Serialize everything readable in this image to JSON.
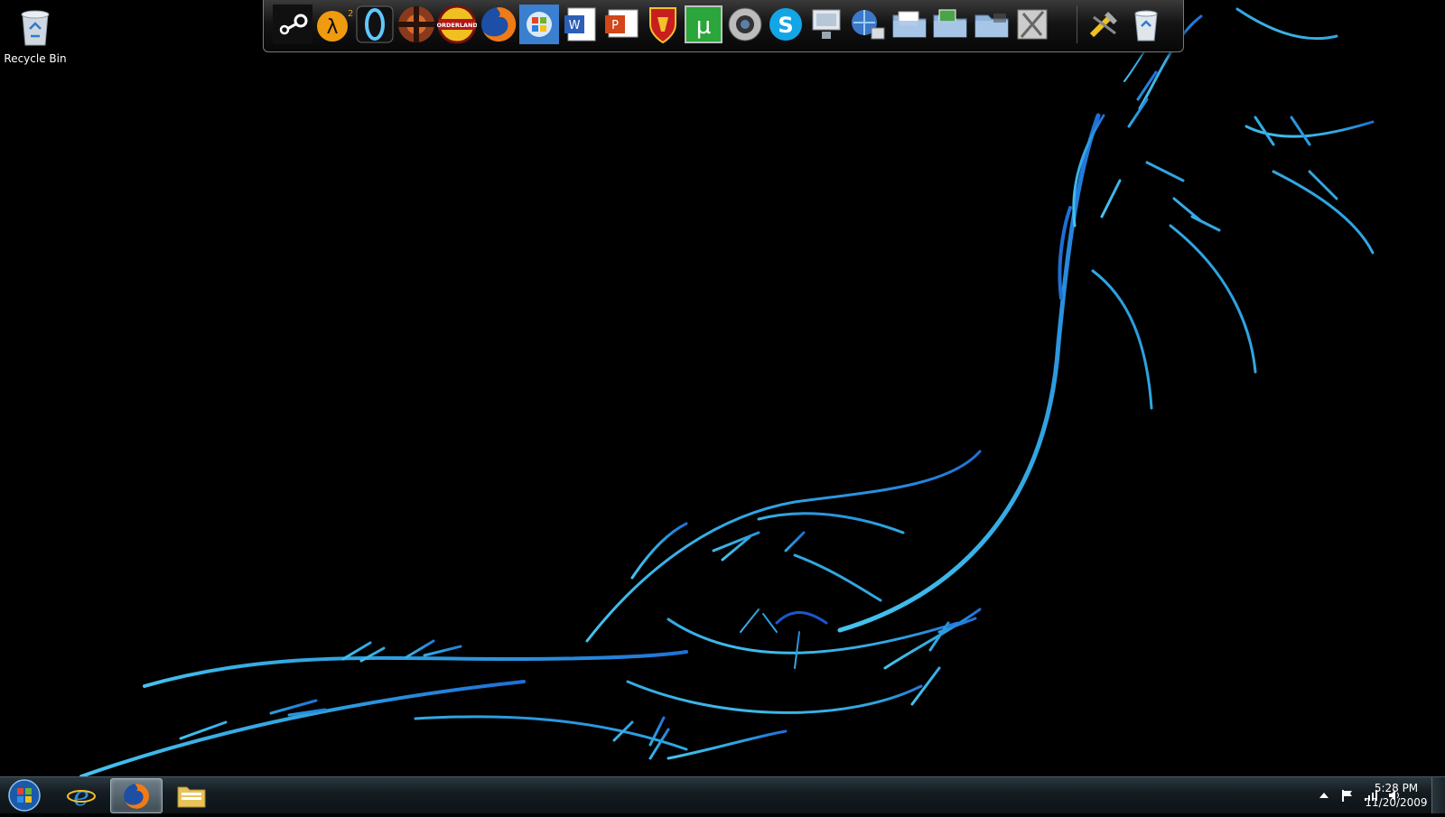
{
  "desktop": {
    "icons": [
      {
        "label": "Recycle Bin",
        "icon": "recycle-bin-icon"
      }
    ]
  },
  "dock": {
    "items": [
      {
        "app": "Steam",
        "icon": "steam-icon"
      },
      {
        "app": "Half-Life 2",
        "icon": "half-life-2-icon"
      },
      {
        "app": "Portal",
        "icon": "portal-icon"
      },
      {
        "app": "Team Fortress 2",
        "icon": "team-fortress-2-icon"
      },
      {
        "app": "Borderlands",
        "icon": "borderlands-icon",
        "text": "BORDERLANDS"
      },
      {
        "app": "Firefox",
        "icon": "firefox-icon"
      },
      {
        "app": "Windows",
        "icon": "windows-icon"
      },
      {
        "app": "Word",
        "icon": "word-icon"
      },
      {
        "app": "PowerPoint",
        "icon": "powerpoint-icon"
      },
      {
        "app": "Game Shield",
        "icon": "shield-game-icon"
      },
      {
        "app": "uTorrent",
        "icon": "utorrent-icon"
      },
      {
        "app": "Webcam",
        "icon": "webcam-icon"
      },
      {
        "app": "Skype",
        "icon": "skype-icon"
      },
      {
        "app": "Computer",
        "icon": "computer-icon"
      },
      {
        "app": "Network",
        "icon": "network-icon"
      },
      {
        "app": "Documents",
        "icon": "documents-folder-icon"
      },
      {
        "app": "Pictures",
        "icon": "pictures-folder-icon"
      },
      {
        "app": "Downloads",
        "icon": "downloads-folder-icon"
      },
      {
        "app": "Control Panel",
        "icon": "control-panel-icon"
      },
      {
        "app": "Tools",
        "icon": "tools-icon"
      },
      {
        "app": "Recycle Bin",
        "icon": "dock-recycle-bin-icon"
      }
    ]
  },
  "taskbar": {
    "pinned": [
      {
        "app": "Internet Explorer",
        "icon": "internet-explorer-icon",
        "active": false
      },
      {
        "app": "Firefox",
        "icon": "firefox-taskbar-icon",
        "active": true
      },
      {
        "app": "Windows Explorer",
        "icon": "windows-explorer-icon",
        "active": false
      }
    ],
    "tray": {
      "icons": [
        "show-hidden-icons-icon",
        "action-center-flag-icon",
        "network-signal-icon",
        "volume-icon"
      ]
    },
    "clock": {
      "time": "5:28 PM",
      "date": "11/20/2009"
    }
  },
  "colors": {
    "wallpaper_accent": "#3fb4e6",
    "wallpaper_deep": "#1b6fd1",
    "background": "#000000"
  }
}
